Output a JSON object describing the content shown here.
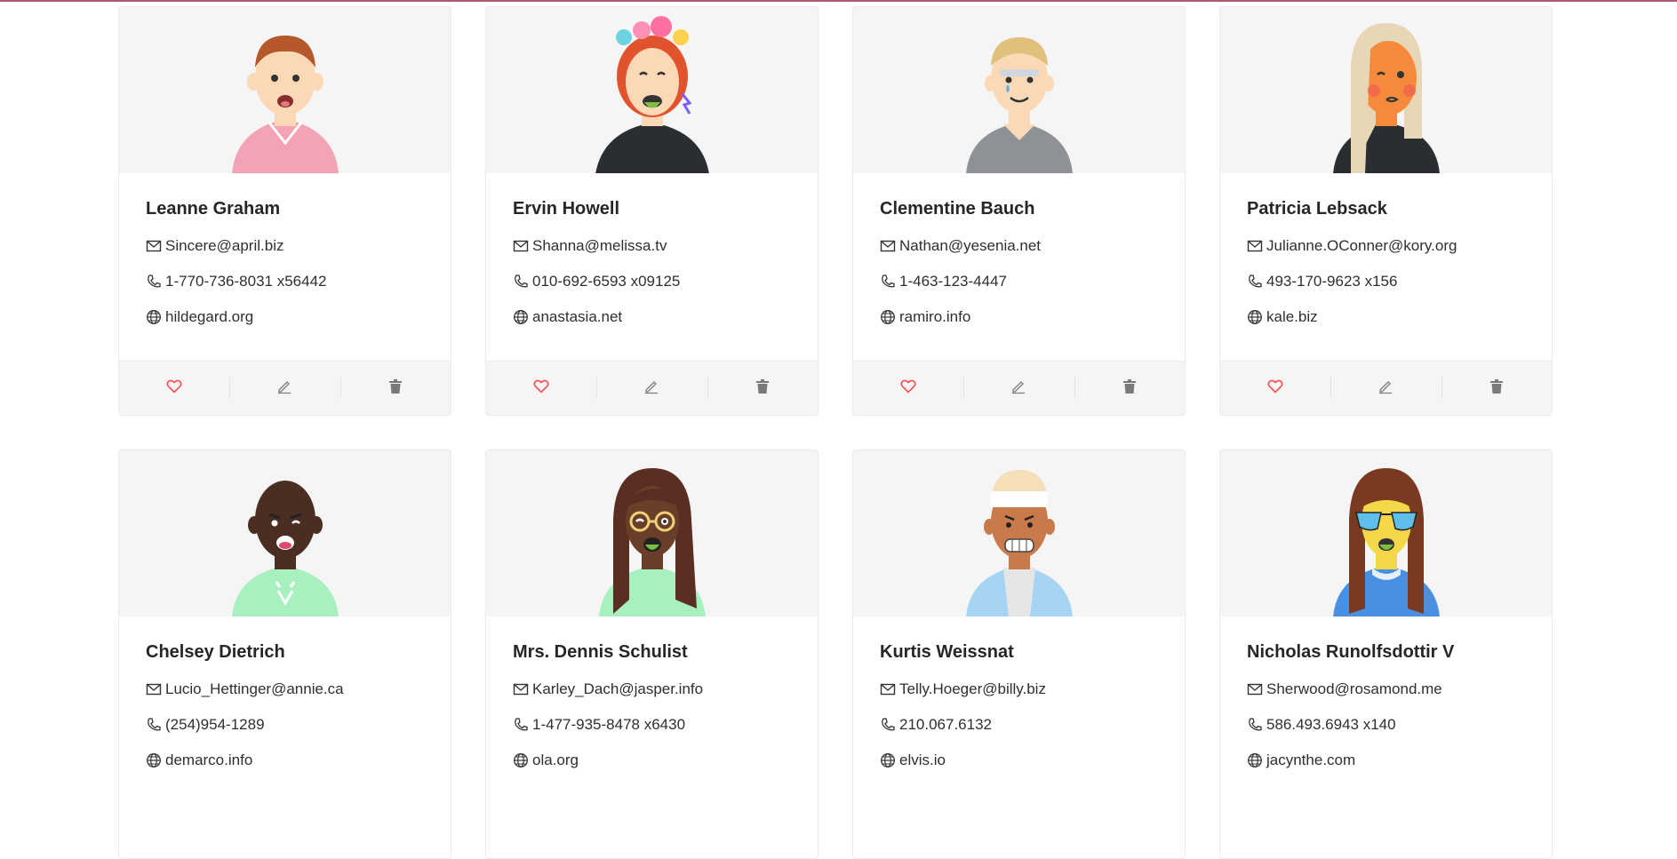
{
  "colors": {
    "heart": "#ff4d4f",
    "icon_gray": "#7a7a7a",
    "card_bg": "#f5f5f5"
  },
  "icons": {
    "email": "mail-icon",
    "phone": "phone-icon",
    "website": "globe-icon",
    "like": "heart-icon",
    "edit": "edit-icon",
    "delete": "delete-icon"
  },
  "users": [
    {
      "name": "Leanne Graham",
      "email": "Sincere@april.biz",
      "phone": "1-770-736-8031 x56442",
      "website": "hildegard.org"
    },
    {
      "name": "Ervin Howell",
      "email": "Shanna@melissa.tv",
      "phone": "010-692-6593 x09125",
      "website": "anastasia.net"
    },
    {
      "name": "Clementine Bauch",
      "email": "Nathan@yesenia.net",
      "phone": "1-463-123-4447",
      "website": "ramiro.info"
    },
    {
      "name": "Patricia Lebsack",
      "email": "Julianne.OConner@kory.org",
      "phone": "493-170-9623 x156",
      "website": "kale.biz"
    },
    {
      "name": "Chelsey Dietrich",
      "email": "Lucio_Hettinger@annie.ca",
      "phone": "(254)954-1289",
      "website": "demarco.info"
    },
    {
      "name": "Mrs. Dennis Schulist",
      "email": "Karley_Dach@jasper.info",
      "phone": "1-477-935-8478 x6430",
      "website": "ola.org"
    },
    {
      "name": "Kurtis Weissnat",
      "email": "Telly.Hoeger@billy.biz",
      "phone": "210.067.6132",
      "website": "elvis.io"
    },
    {
      "name": "Nicholas Runolfsdottir V",
      "email": "Sherwood@rosamond.me",
      "phone": "586.493.6943 x140",
      "website": "jacynthe.com"
    }
  ]
}
